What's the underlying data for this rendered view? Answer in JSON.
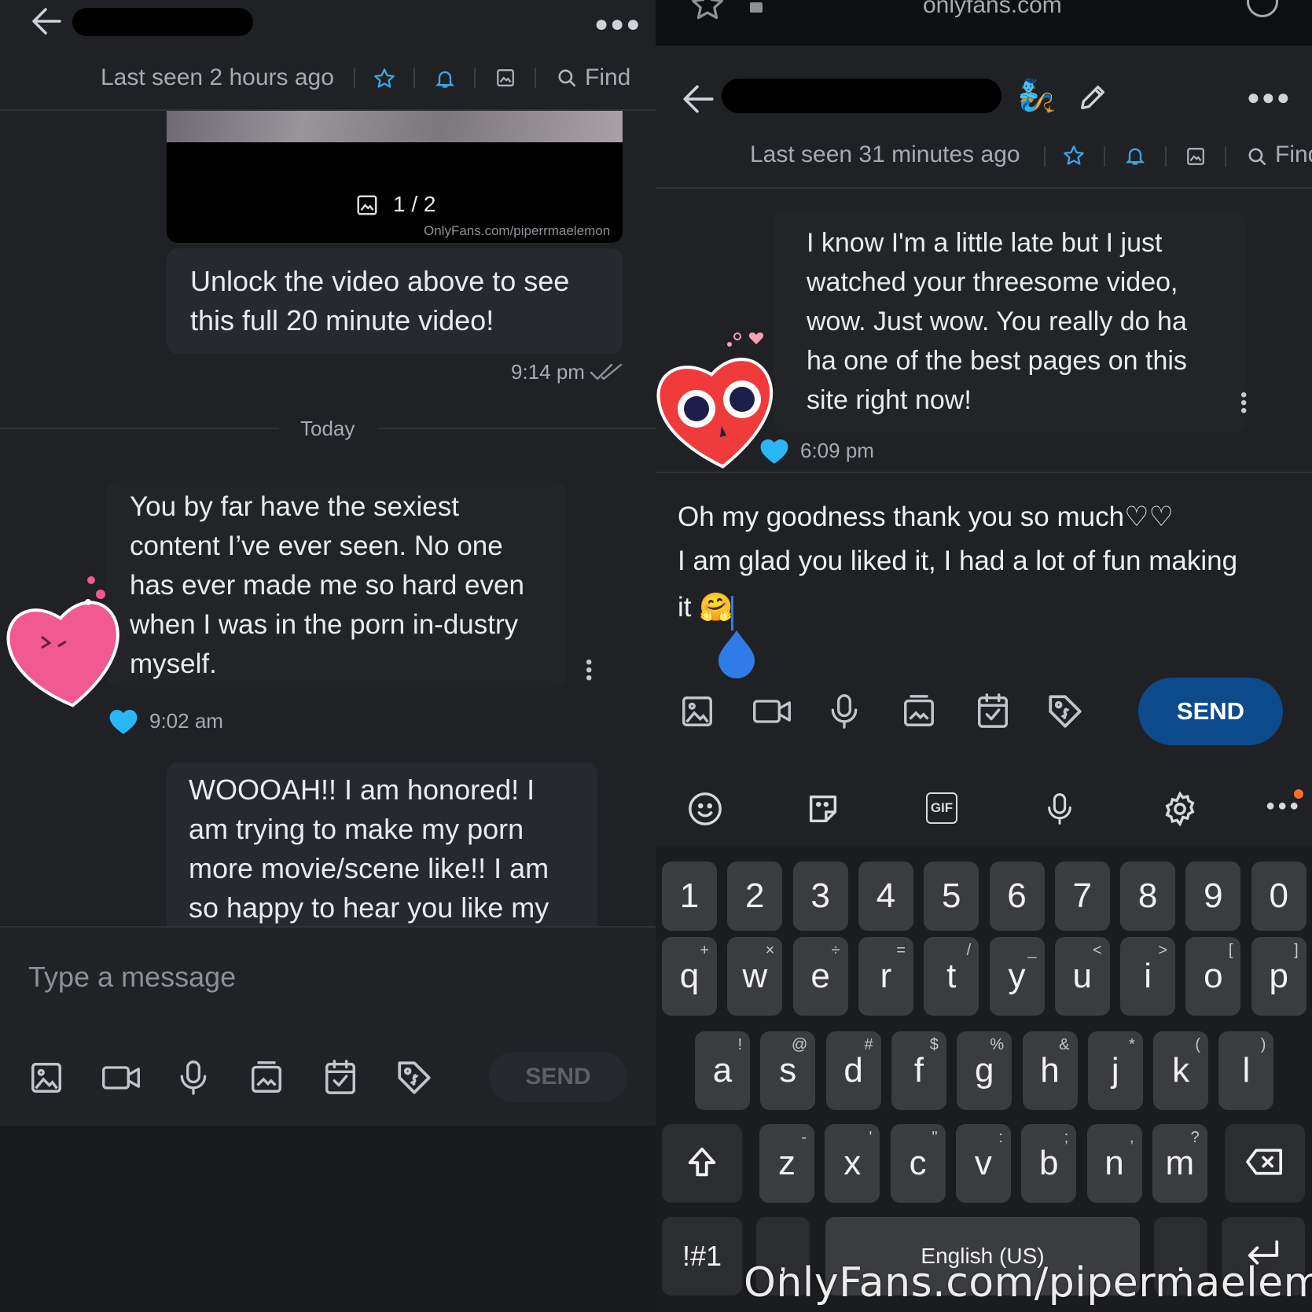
{
  "left": {
    "header": {
      "status": "Last seen 2 hours ago",
      "find_label": "Find"
    },
    "media": {
      "counter": "1 / 2",
      "credit": "OnlyFans.com/piperrmaelemon"
    },
    "messages": [
      {
        "text": "Unlock the video above to see this full 20 minute video!",
        "time": "9:14 pm"
      },
      {
        "text": "You by far have the sexiest content I’ve ever seen. No one has ever made me so hard even when I was in the porn in-dustry myself.",
        "time": "9:02 am"
      },
      {
        "text": "WOOOAH!! I am honored! I am trying to make my porn more movie/scene like!! I am so happy to hear you like my"
      }
    ],
    "date_divider": "Today",
    "composer": {
      "placeholder": "Type a message",
      "send_label": "SEND"
    }
  },
  "right": {
    "browser": {
      "url": "onlyfans.com"
    },
    "header": {
      "status": "Last seen 31 minutes ago",
      "find_label": "Find"
    },
    "messages": [
      {
        "text": "I know I'm a little late but I just watched your threesome video, wow. Just wow. You really do ha ha one of the best pages on this site right now!",
        "time": "6:09 pm"
      }
    ],
    "composer": {
      "text_line1": "Oh my goodness thank you so much♡♡",
      "text_line2": "I am glad you liked it, I had a lot of fun making",
      "text_line3": "it 🤗",
      "send_label": "SEND"
    },
    "keyboard": {
      "toolbar_gif": "GIF",
      "numbers": [
        "1",
        "2",
        "3",
        "4",
        "5",
        "6",
        "7",
        "8",
        "9",
        "0"
      ],
      "row1": [
        {
          "k": "q",
          "s": "+"
        },
        {
          "k": "w",
          "s": "×"
        },
        {
          "k": "e",
          "s": "÷"
        },
        {
          "k": "r",
          "s": "="
        },
        {
          "k": "t",
          "s": "/"
        },
        {
          "k": "y",
          "s": "_"
        },
        {
          "k": "u",
          "s": "<"
        },
        {
          "k": "i",
          "s": ">"
        },
        {
          "k": "o",
          "s": "["
        },
        {
          "k": "p",
          "s": "]"
        }
      ],
      "row2": [
        {
          "k": "a",
          "s": "!"
        },
        {
          "k": "s",
          "s": "@"
        },
        {
          "k": "d",
          "s": "#"
        },
        {
          "k": "f",
          "s": "$"
        },
        {
          "k": "g",
          "s": "%"
        },
        {
          "k": "h",
          "s": "&"
        },
        {
          "k": "j",
          "s": "*"
        },
        {
          "k": "k",
          "s": "("
        },
        {
          "k": "l",
          "s": ")"
        }
      ],
      "row3": [
        {
          "k": "z",
          "s": "-"
        },
        {
          "k": "x",
          "s": "'"
        },
        {
          "k": "c",
          "s": "\""
        },
        {
          "k": "v",
          "s": ":"
        },
        {
          "k": "b",
          "s": ";"
        },
        {
          "k": "n",
          "s": ","
        },
        {
          "k": "m",
          "s": "?"
        }
      ],
      "symbols_label": "!#1",
      "space_label": "English (US)"
    },
    "watermark": "OnlyFans.com/pipermaelemon"
  },
  "colors": {
    "accent": "#3aa7e6",
    "send_active": "#0d4a8c",
    "background": "#1f2124"
  }
}
